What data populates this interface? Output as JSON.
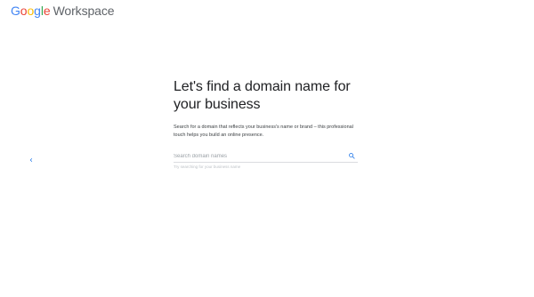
{
  "header": {
    "logo_letters": [
      "G",
      "o",
      "o",
      "g",
      "l",
      "e"
    ],
    "product_name": "Workspace"
  },
  "nav": {
    "back_icon": "chevron-left-icon"
  },
  "main": {
    "title": "Let's find a domain name for your business",
    "description": "Search for a domain that reflects your business's name or brand – this professional touch helps you build an online presence.",
    "search": {
      "placeholder": "Search domain names",
      "value": "",
      "helper": "Try searching for your business name",
      "icon": "search-icon"
    }
  },
  "colors": {
    "google_blue": "#4285F4",
    "google_red": "#EA4335",
    "google_yellow": "#FBBC05",
    "google_green": "#34A853",
    "text_secondary": "#5f6368"
  }
}
